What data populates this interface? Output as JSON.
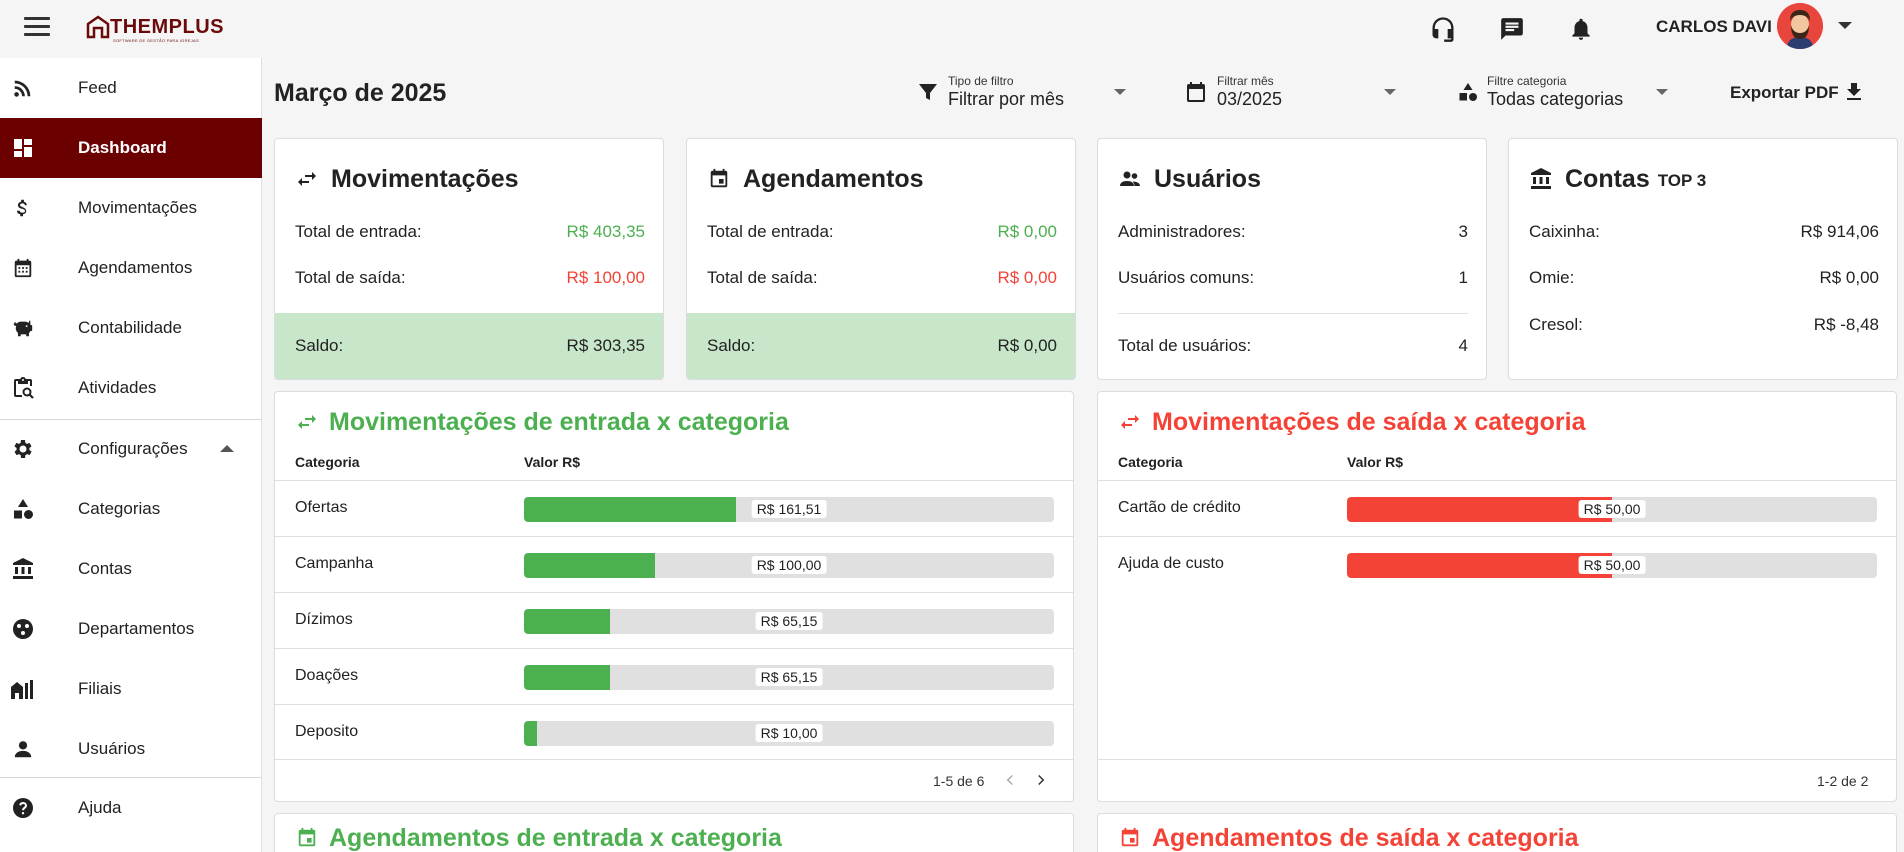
{
  "header": {
    "logo_text": "THEMPLUS",
    "logo_subtitle": "SOFTWARE DE GESTÃO PARA IGREJAS",
    "user_name": "CARLOS DAVI"
  },
  "sidebar": {
    "items": [
      {
        "label": "Feed",
        "icon": "rss-icon"
      },
      {
        "label": "Dashboard",
        "icon": "dashboard-icon",
        "active": true
      },
      {
        "label": "Movimentações",
        "icon": "dollar-icon"
      },
      {
        "label": "Agendamentos",
        "icon": "calendar-icon"
      },
      {
        "label": "Contabilidade",
        "icon": "piggy-bank-icon"
      },
      {
        "label": "Atividades",
        "icon": "clipboard-search-icon"
      },
      {
        "label": "Configurações",
        "icon": "gear-icon"
      },
      {
        "label": "Categorias",
        "icon": "shapes-icon"
      },
      {
        "label": "Contas",
        "icon": "bank-icon"
      },
      {
        "label": "Departamentos",
        "icon": "departments-icon"
      },
      {
        "label": "Filiais",
        "icon": "branches-icon"
      },
      {
        "label": "Usuários",
        "icon": "user-icon"
      },
      {
        "label": "Ajuda",
        "icon": "help-icon"
      }
    ]
  },
  "page": {
    "title": "Março de 2025",
    "filters": {
      "type_label": "Tipo de filtro",
      "type_value": "Filtrar por mês",
      "month_label": "Filtrar mês",
      "month_value": "03/2025",
      "category_label": "Filtre categoria",
      "category_value": "Todas categorias"
    },
    "export_label": "Exportar PDF"
  },
  "cards": {
    "movimentacoes": {
      "title": "Movimentações",
      "entrada_label": "Total de entrada:",
      "entrada_value": "R$ 403,35",
      "saida_label": "Total de saída:",
      "saida_value": "R$ 100,00",
      "saldo_label": "Saldo:",
      "saldo_value": "R$ 303,35"
    },
    "agendamentos": {
      "title": "Agendamentos",
      "entrada_label": "Total de entrada:",
      "entrada_value": "R$ 0,00",
      "saida_label": "Total de saída:",
      "saida_value": "R$ 0,00",
      "saldo_label": "Saldo:",
      "saldo_value": "R$ 0,00"
    },
    "usuarios": {
      "title": "Usuários",
      "admins_label": "Administradores:",
      "admins_value": "3",
      "comuns_label": "Usuários comuns:",
      "comuns_value": "1",
      "total_label": "Total de usuários:",
      "total_value": "4"
    },
    "contas": {
      "title": "Contas",
      "subtitle": "TOP 3",
      "rows": [
        {
          "label": "Caixinha:",
          "value": "R$ 914,06"
        },
        {
          "label": "Omie:",
          "value": "R$ 0,00"
        },
        {
          "label": "Cresol:",
          "value": "R$ -8,48"
        }
      ]
    }
  },
  "entrada_categoria": {
    "title": "Movimentações de entrada x categoria",
    "col_categoria": "Categoria",
    "col_valor": "Valor R$",
    "rows": [
      {
        "name": "Ofertas",
        "value": "R$ 161,51",
        "fill": 0.4
      },
      {
        "name": "Campanha",
        "value": "R$ 100,00",
        "fill": 0.248
      },
      {
        "name": "Dízimos",
        "value": "R$ 65,15",
        "fill": 0.162
      },
      {
        "name": "Doações",
        "value": "R$ 65,15",
        "fill": 0.162
      },
      {
        "name": "Deposito",
        "value": "R$ 10,00",
        "fill": 0.025
      }
    ],
    "pagination": "1-5 de 6"
  },
  "saida_categoria": {
    "title": "Movimentações de saída x categoria",
    "col_categoria": "Categoria",
    "col_valor": "Valor R$",
    "rows": [
      {
        "name": "Cartão de crédito",
        "value": "R$ 50,00",
        "fill": 0.5
      },
      {
        "name": "Ajuda de custo",
        "value": "R$ 50,00",
        "fill": 0.5
      }
    ],
    "pagination": "1-2 de 2"
  },
  "agend_entrada": {
    "title": "Agendamentos de entrada x categoria"
  },
  "agend_saida": {
    "title": "Agendamentos de saída x categoria"
  },
  "colors": {
    "brand": "#6b0000",
    "green": "#4caf50",
    "red": "#f44336",
    "saldo_bg": "#c8e6c9"
  }
}
